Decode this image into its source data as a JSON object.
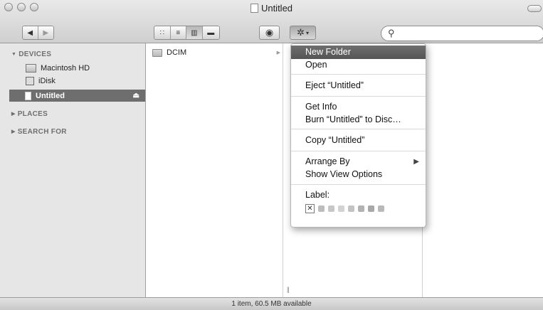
{
  "window": {
    "title": "Untitled"
  },
  "toolbar": {
    "back_icon": "back-arrow-icon",
    "forward_icon": "forward-arrow-icon",
    "view_modes": [
      "icon-view",
      "list-view",
      "column-view",
      "coverflow-view"
    ],
    "active_view": "column-view",
    "action_menu_icon": "gear-icon",
    "quicklook_icon": "eye-icon",
    "search_placeholder": ""
  },
  "sidebar": {
    "sections": {
      "devices": "DEVICES",
      "places": "PLACES",
      "search_for": "SEARCH FOR"
    },
    "devices": [
      {
        "label": "Macintosh HD",
        "icon": "hard-drive-icon"
      },
      {
        "label": "iDisk",
        "icon": "idisk-icon"
      },
      {
        "label": "Untitled",
        "icon": "volume-icon",
        "selected": true
      }
    ]
  },
  "columns": {
    "col1": [
      {
        "label": "DCIM",
        "icon": "folder-icon"
      }
    ]
  },
  "menu": {
    "new_folder": "New Folder",
    "open": "Open",
    "eject": "Eject “Untitled”",
    "get_info": "Get Info",
    "burn": "Burn “Untitled” to Disc…",
    "copy": "Copy “Untitled”",
    "arrange_by": "Arrange By",
    "show_view_options": "Show View Options",
    "label": "Label:",
    "label_colors": [
      "#bdbdbd",
      "#c7c7c7",
      "#d2d2d2",
      "#c3c3c3",
      "#b2b2b2",
      "#a8a8a8",
      "#b9b9b9"
    ]
  },
  "status": {
    "text": "1 item, 60.5 MB available"
  }
}
